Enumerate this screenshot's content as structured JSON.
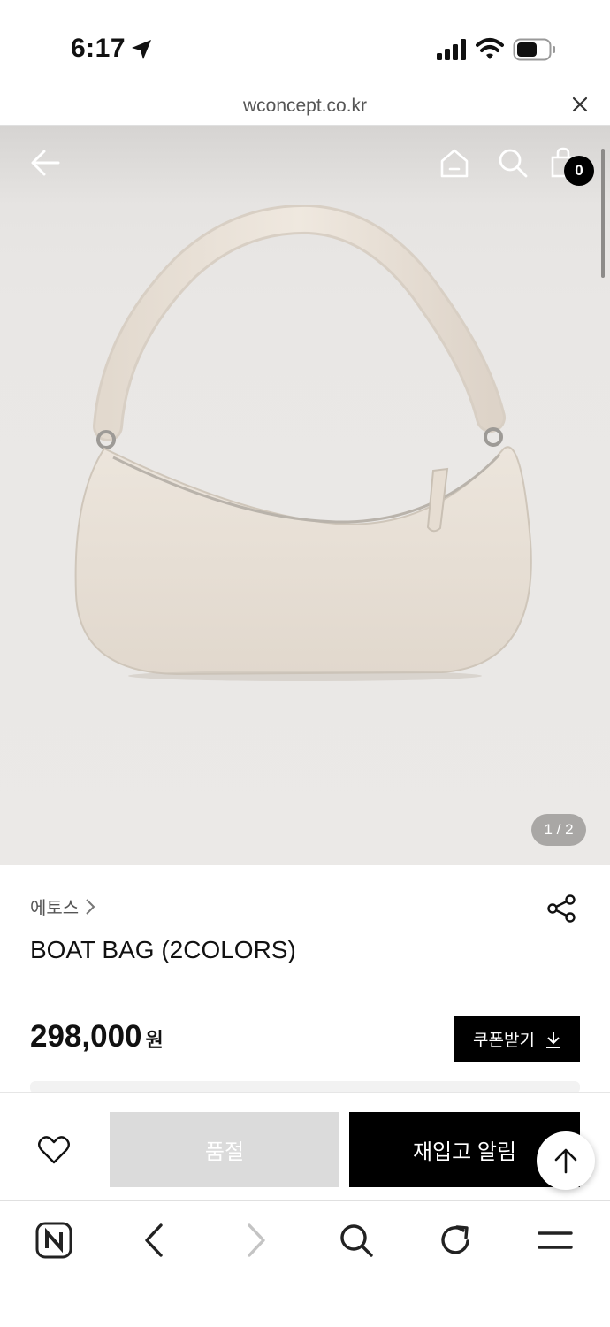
{
  "status_bar": {
    "time": "6:17",
    "icons": [
      "location-arrow-icon",
      "signal-bars-icon",
      "wifi-icon",
      "battery-icon"
    ]
  },
  "browser_url": {
    "domain": "wconcept.co.kr",
    "close_icon": "close-icon"
  },
  "product_header": {
    "icons": [
      "back-arrow-icon",
      "home-icon",
      "search-icon",
      "cart-icon"
    ],
    "cart_count": "0"
  },
  "gallery": {
    "pager": "1 / 2",
    "image_subject": "cream leather shoulder bag"
  },
  "product": {
    "brand": "에토스",
    "name": "BOAT BAG (2COLORS)",
    "price": "298,000",
    "currency": "원",
    "coupon_label": "쿠폰받기"
  },
  "actions": {
    "soldout_label": "품절",
    "restock_label": "재입고 알림",
    "wishlist_icon": "heart-icon",
    "scroll_top_icon": "arrow-up-icon"
  },
  "browser_toolbar": {
    "icons": [
      "naver-logo-icon",
      "back-chevron-icon",
      "forward-chevron-icon",
      "search-icon",
      "reload-icon",
      "menu-icon"
    ]
  },
  "colors": {
    "accent": "#000000",
    "soldout_bg": "#dbdbdb",
    "hero_bg": "#ebe9e7",
    "pager_bg": "#a9a7a5",
    "bag": "#e4dbd0"
  }
}
